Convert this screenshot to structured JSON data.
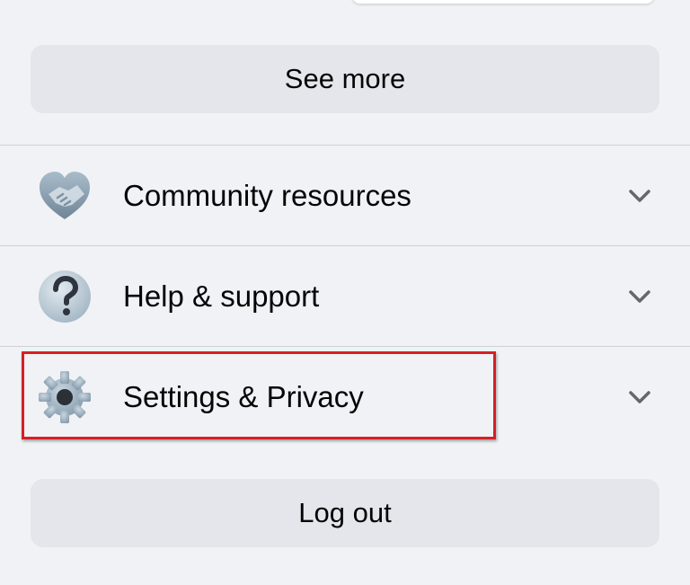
{
  "menu": {
    "see_more_label": "See more",
    "items": [
      {
        "label": "Community resources",
        "icon": "handshake-icon"
      },
      {
        "label": "Help & support",
        "icon": "question-mark-icon"
      },
      {
        "label": "Settings & Privacy",
        "icon": "gear-icon"
      }
    ],
    "logout_label": "Log out"
  },
  "colors": {
    "background": "#f0f2f5",
    "button": "#e4e6eb",
    "highlight": "#d61f26",
    "icon": "#8fa3b3"
  }
}
